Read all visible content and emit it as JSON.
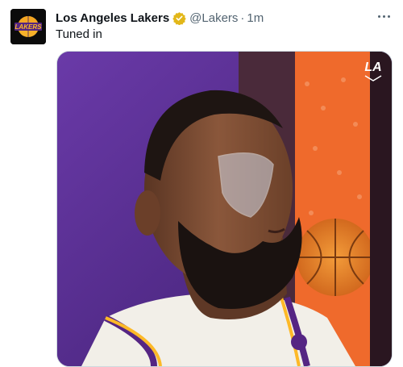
{
  "tweet": {
    "author": {
      "name": "Los Angeles Lakers",
      "handle": "@Lakers",
      "avatar_text": "LAKERS"
    },
    "separator": "·",
    "time": "1m",
    "text": "Tuned in",
    "icons": {
      "verified": "verified-badge-icon",
      "more": "more-options-icon"
    },
    "media": {
      "watermark": "LA"
    }
  },
  "colors": {
    "verified_gold": "#e2b719",
    "lakers_purple": "#552583",
    "lakers_gold": "#fdb927"
  }
}
